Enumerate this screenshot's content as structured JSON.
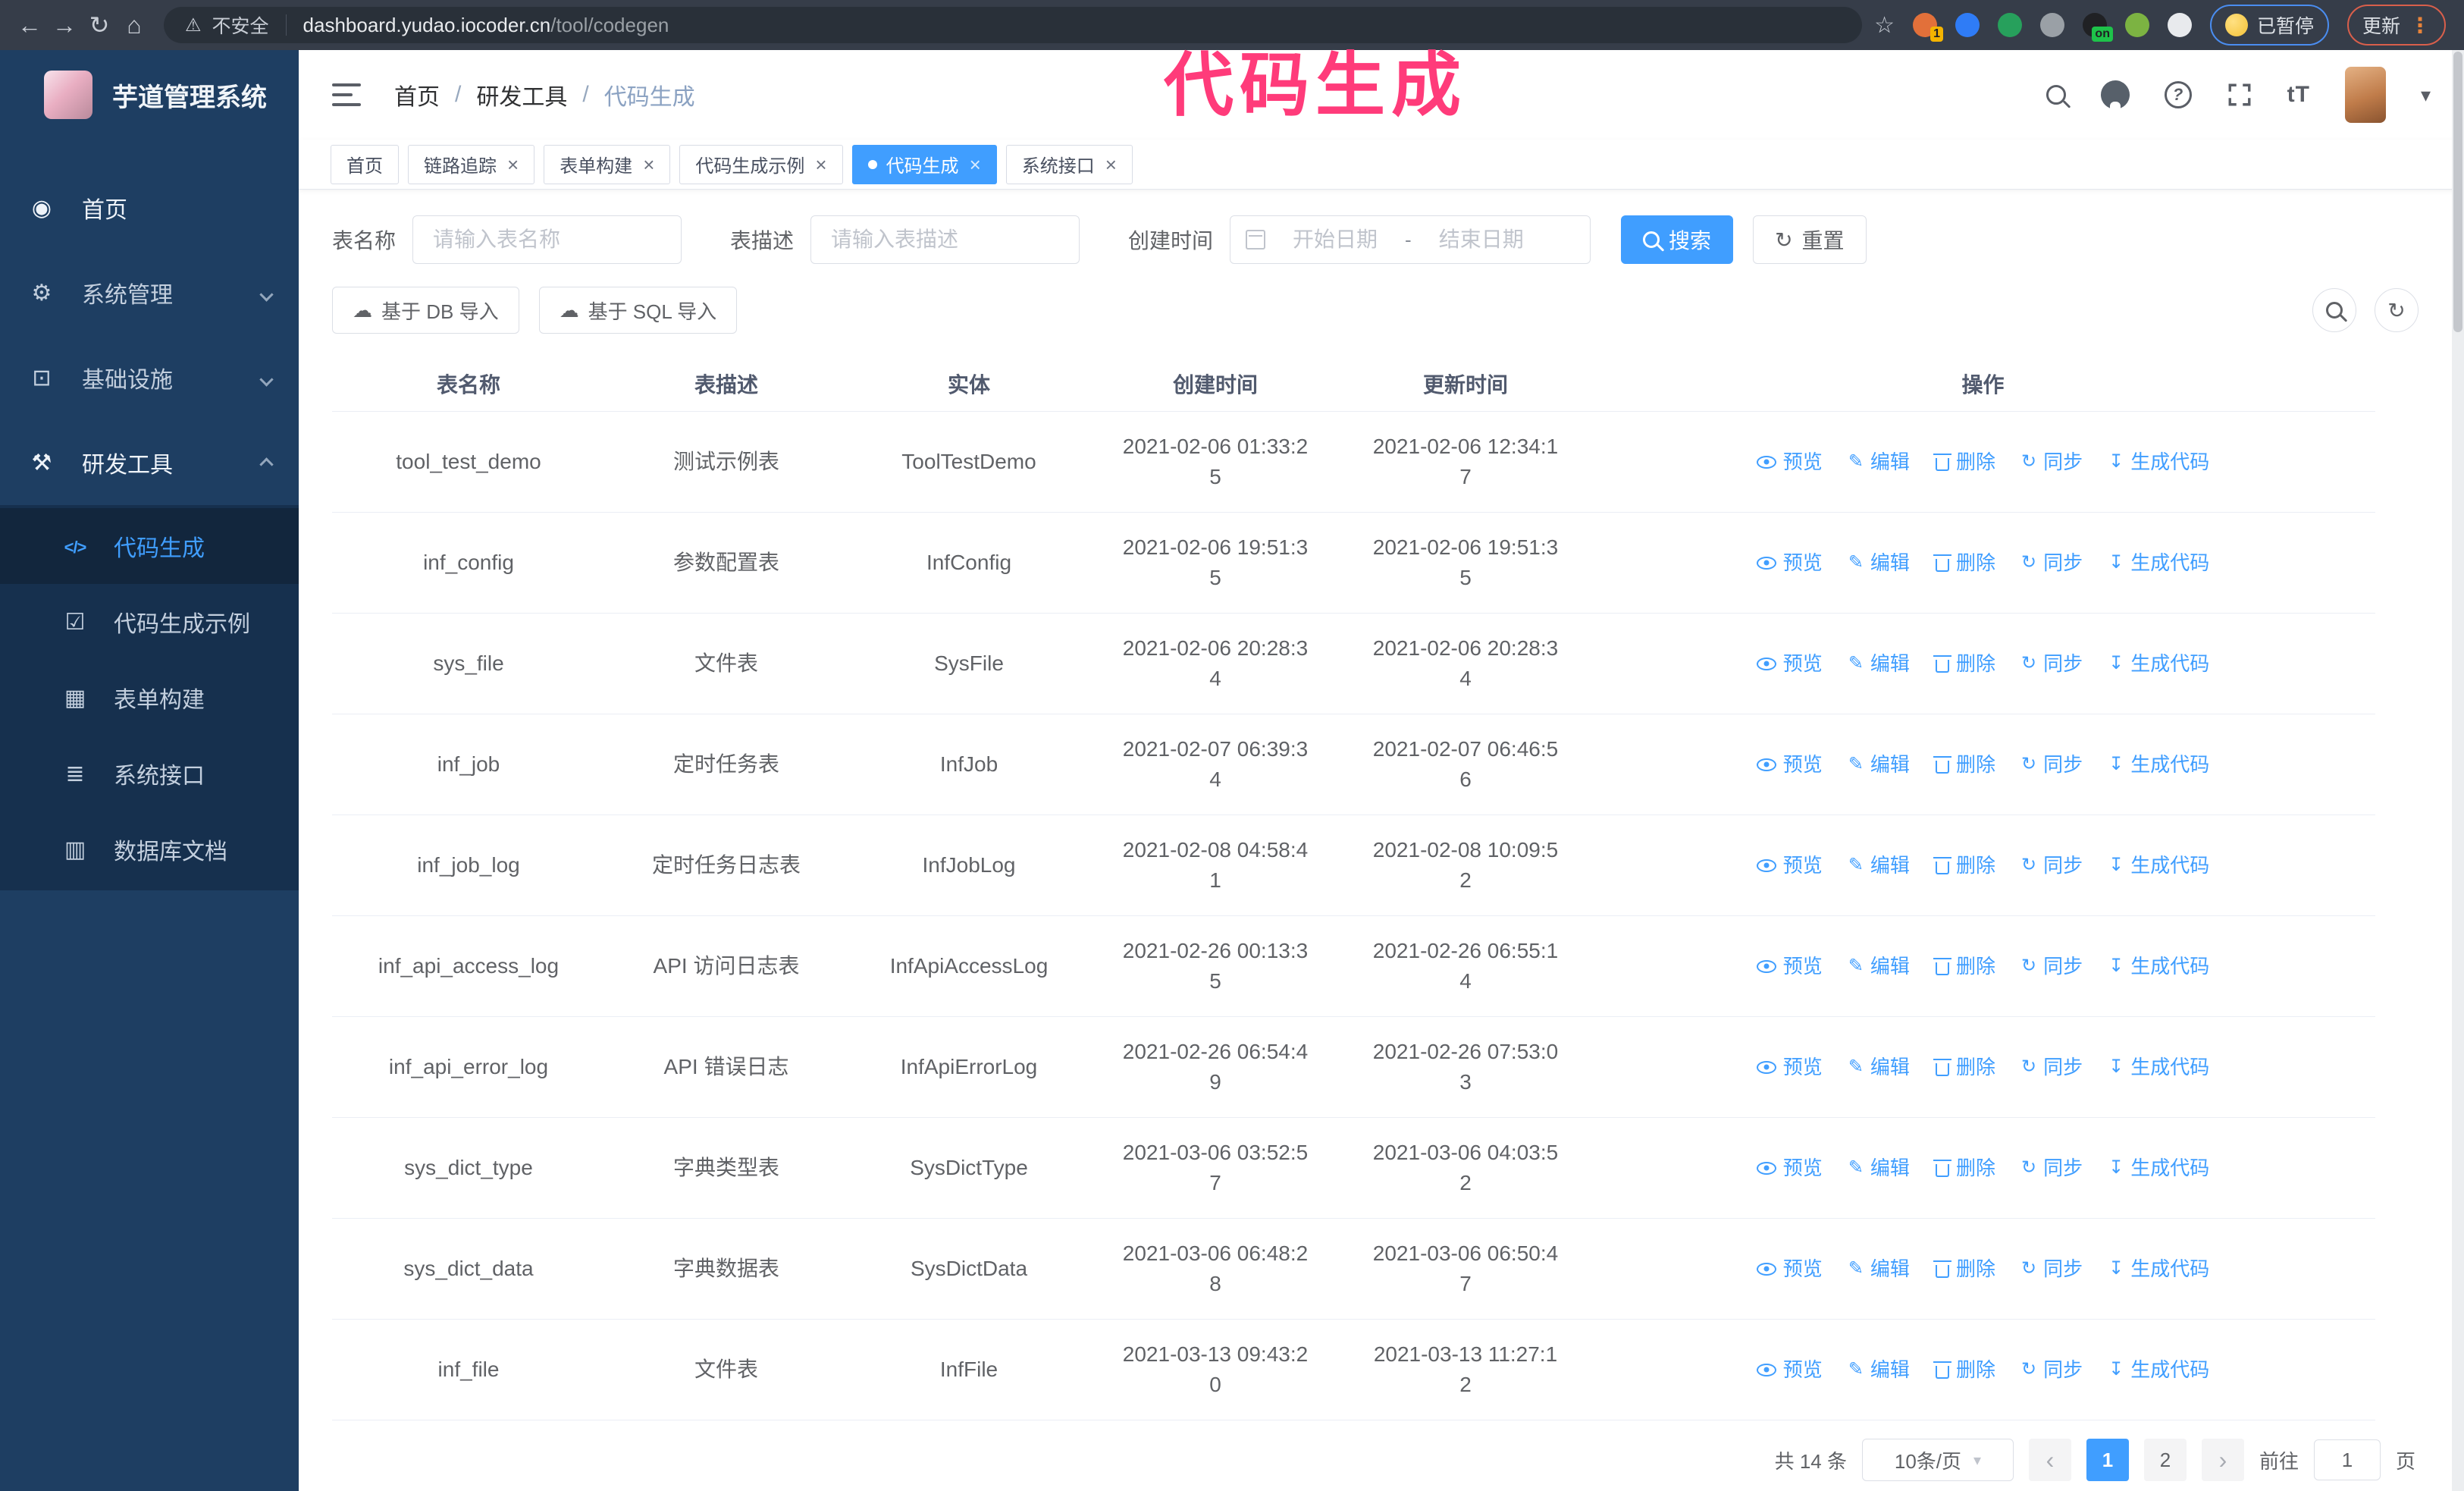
{
  "browser": {
    "nav_icons": [
      {
        "name": "back-icon",
        "icon": "back"
      },
      {
        "name": "forward-icon",
        "icon": "forward"
      },
      {
        "name": "reload-icon",
        "icon": "reload"
      },
      {
        "name": "home-icon",
        "icon": "home"
      }
    ],
    "security_warning": "不安全",
    "url_host": "dashboard.yudao.iocoder.cn",
    "url_path": "/tool/codegen",
    "extensions": [
      {
        "color": "#e2703a",
        "badge": "1",
        "badge_color": "#f4b400"
      },
      {
        "color": "#2f7cf6"
      },
      {
        "color": "#27a05c"
      },
      {
        "color": "#9aa0a6"
      },
      {
        "color": "#202124",
        "badge": "on",
        "badge_color": "#1ec24a"
      },
      {
        "color": "#7cb342"
      },
      {
        "color": "#e8eaed"
      }
    ],
    "paused_badge": "已暂停",
    "update_button": "更新"
  },
  "annotation": {
    "text": "代码生成",
    "color": "#ff3b7a"
  },
  "sidebar": {
    "logo_title": "芋道管理系统",
    "items": [
      {
        "label": "首页",
        "icon": "dashboard",
        "bright": true
      },
      {
        "label": "系统管理",
        "icon": "gear",
        "chev": "chevdown"
      },
      {
        "label": "基础设施",
        "icon": "monitor",
        "chev": "chevdown"
      },
      {
        "label": "研发工具",
        "icon": "toolbox",
        "chev": "chevup",
        "bright": true
      }
    ],
    "subitems": [
      {
        "label": "代码生成",
        "icon": "code",
        "active": true
      },
      {
        "label": "代码生成示例",
        "icon": "shield"
      },
      {
        "label": "表单构建",
        "icon": "form"
      },
      {
        "label": "系统接口",
        "icon": "sliders"
      },
      {
        "label": "数据库文档",
        "icon": "database"
      }
    ]
  },
  "header": {
    "breadcrumb": [
      {
        "label": "首页"
      },
      {
        "label": "研发工具"
      },
      {
        "label": "代码生成",
        "last": true
      }
    ],
    "right_icons": [
      {
        "name": "search-icon",
        "icon": "search"
      },
      {
        "name": "github-icon",
        "icon": "github"
      },
      {
        "name": "help-icon",
        "icon": "help"
      },
      {
        "name": "fullscreen-icon",
        "icon": "fullscreen"
      },
      {
        "name": "font-size-icon",
        "icon": "fontsize"
      }
    ]
  },
  "tabs": [
    {
      "label": "首页"
    },
    {
      "label": "链路追踪",
      "closable": true
    },
    {
      "label": "表单构建",
      "closable": true
    },
    {
      "label": "代码生成示例",
      "closable": true
    },
    {
      "label": "代码生成",
      "closable": true,
      "active": true
    },
    {
      "label": "系统接口",
      "closable": true
    }
  ],
  "filters": {
    "name_label": "表名称",
    "name_placeholder": "请输入表名称",
    "desc_label": "表描述",
    "desc_placeholder": "请输入表描述",
    "time_label": "创建时间",
    "start_placeholder": "开始日期",
    "range_separator": "-",
    "end_placeholder": "结束日期",
    "search": "搜索",
    "reset": "重置"
  },
  "toolbar": {
    "import_db": "基于 DB 导入",
    "import_sql": "基于 SQL 导入"
  },
  "table": {
    "columns": [
      "表名称",
      "表描述",
      "实体",
      "创建时间",
      "更新时间",
      "操作"
    ],
    "actions": [
      {
        "name": "preview",
        "label": "预览",
        "icon": "eye"
      },
      {
        "name": "edit",
        "label": "编辑",
        "icon": "edit"
      },
      {
        "name": "delete",
        "label": "删除",
        "icon": "trash"
      },
      {
        "name": "sync",
        "label": "同步",
        "icon": "sync"
      },
      {
        "name": "generate",
        "label": "生成代码",
        "icon": "download"
      }
    ],
    "rows": [
      {
        "name": "tool_test_demo",
        "desc": "测试示例表",
        "entity": "ToolTestDemo",
        "created": "2021-02-06 01:33:25",
        "updated": "2021-02-06 12:34:17"
      },
      {
        "name": "inf_config",
        "desc": "参数配置表",
        "entity": "InfConfig",
        "created": "2021-02-06 19:51:35",
        "updated": "2021-02-06 19:51:35"
      },
      {
        "name": "sys_file",
        "desc": "文件表",
        "entity": "SysFile",
        "created": "2021-02-06 20:28:34",
        "updated": "2021-02-06 20:28:34"
      },
      {
        "name": "inf_job",
        "desc": "定时任务表",
        "entity": "InfJob",
        "created": "2021-02-07 06:39:34",
        "updated": "2021-02-07 06:46:56"
      },
      {
        "name": "inf_job_log",
        "desc": "定时任务日志表",
        "entity": "InfJobLog",
        "created": "2021-02-08 04:58:41",
        "updated": "2021-02-08 10:09:52"
      },
      {
        "name": "inf_api_access_log",
        "desc": "API 访问日志表",
        "entity": "InfApiAccessLog",
        "created": "2021-02-26 00:13:35",
        "updated": "2021-02-26 06:55:14"
      },
      {
        "name": "inf_api_error_log",
        "desc": "API 错误日志",
        "entity": "InfApiErrorLog",
        "created": "2021-02-26 06:54:49",
        "updated": "2021-02-26 07:53:03"
      },
      {
        "name": "sys_dict_type",
        "desc": "字典类型表",
        "entity": "SysDictType",
        "created": "2021-03-06 03:52:57",
        "updated": "2021-03-06 04:03:52"
      },
      {
        "name": "sys_dict_data",
        "desc": "字典数据表",
        "entity": "SysDictData",
        "created": "2021-03-06 06:48:28",
        "updated": "2021-03-06 06:50:47"
      },
      {
        "name": "inf_file",
        "desc": "文件表",
        "entity": "InfFile",
        "created": "2021-03-13 09:43:20",
        "updated": "2021-03-13 11:27:12"
      }
    ]
  },
  "pagination": {
    "total": "共 14 条",
    "page_size": "10条/页",
    "pages": [
      {
        "label": "1",
        "active": true
      },
      {
        "label": "2"
      }
    ],
    "goto_label": "前往",
    "goto_value": "1",
    "unit_label": "页"
  }
}
